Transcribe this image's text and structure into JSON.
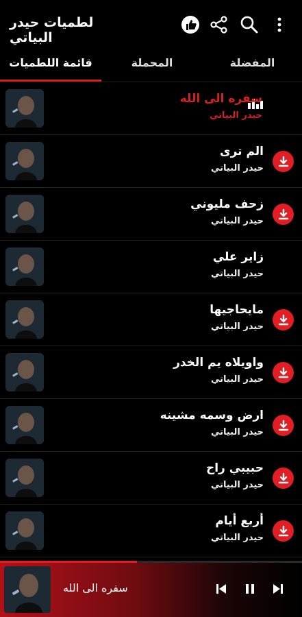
{
  "app": {
    "title": "لطميات حيدر البياتي"
  },
  "toolbar": {
    "icons": [
      "like-icon",
      "share-icon",
      "search-icon",
      "more-vert-icon"
    ]
  },
  "tabs": [
    {
      "label": "قائمة اللطميات",
      "selected": true
    },
    {
      "label": "المحملة",
      "selected": false
    },
    {
      "label": "المفضلة",
      "selected": false
    }
  ],
  "songs": [
    {
      "title": "سفره الى الله",
      "artist": "حيدر البياتي",
      "playing": true
    },
    {
      "title": "الم ترى",
      "artist": "حيدر البياتي",
      "downloadable": true
    },
    {
      "title": "زحف مليوني",
      "artist": "حيدر البياتي",
      "downloadable": true
    },
    {
      "title": "زاير علي",
      "artist": "حيدر البياتي",
      "downloadable": false
    },
    {
      "title": "مايحاجيها",
      "artist": "حيدر البياتي",
      "downloadable": true
    },
    {
      "title": "واويلاه يم الخدر",
      "artist": "حيدر البياتي",
      "downloadable": true
    },
    {
      "title": "ارض وسمه مشينه",
      "artist": "حيدر البياتي",
      "downloadable": true
    },
    {
      "title": "حبيبي راح",
      "artist": "حيدر البياتي",
      "downloadable": true
    },
    {
      "title": "أربع أيام",
      "artist": "حيدر البياتي",
      "downloadable": true
    }
  ],
  "player": {
    "now_playing": "سفره الى الله"
  },
  "colors": {
    "accent": "#e21d23",
    "background": "#000000"
  }
}
